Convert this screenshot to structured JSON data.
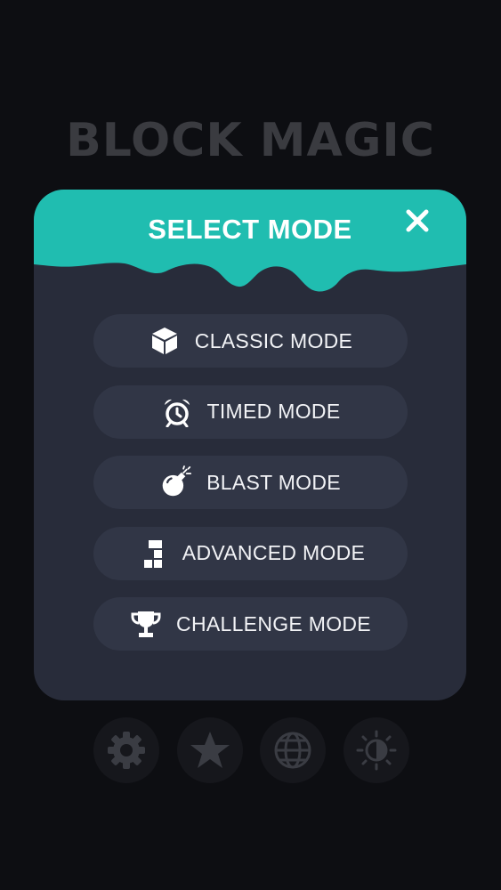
{
  "app": {
    "title": "BLOCK MAGIC"
  },
  "modal": {
    "title": "SELECT MODE",
    "close_icon": "close-icon",
    "header_color": "#20bdb0",
    "modes": [
      {
        "label": "CLASSIC MODE",
        "icon": "cube-icon"
      },
      {
        "label": "TIMED MODE",
        "icon": "alarm-clock-icon"
      },
      {
        "label": "BLAST MODE",
        "icon": "bomb-icon"
      },
      {
        "label": "ADVANCED MODE",
        "icon": "blocks-icon"
      },
      {
        "label": "CHALLENGE MODE",
        "icon": "trophy-icon"
      }
    ]
  },
  "bottom_bar": {
    "buttons": [
      {
        "icon": "gear-icon",
        "action": "settings"
      },
      {
        "icon": "star-icon",
        "action": "rate"
      },
      {
        "icon": "globe-icon",
        "action": "language"
      },
      {
        "icon": "theme-icon",
        "action": "theme"
      }
    ]
  }
}
